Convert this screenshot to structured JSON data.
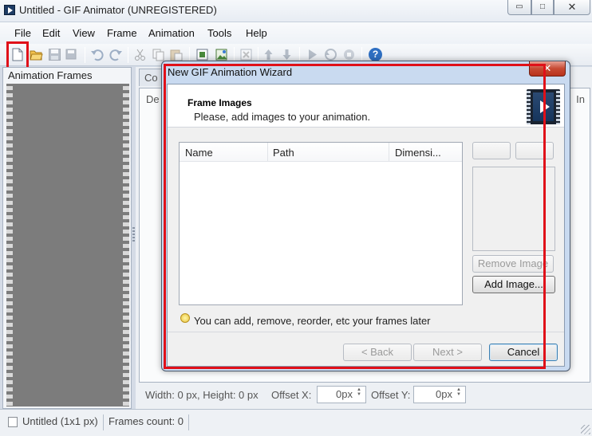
{
  "window": {
    "title": "Untitled - GIF Animator (UNREGISTERED)",
    "minimize_glyph": "▭",
    "maximize_glyph": "□",
    "close_glyph": "✕"
  },
  "menu": [
    "File",
    "Edit",
    "View",
    "Frame",
    "Animation",
    "Tools",
    "Help"
  ],
  "toolbar": {
    "icons": [
      "new-file-icon",
      "open-folder-icon",
      "save-icon",
      "save-as-icon",
      "undo-icon",
      "redo-icon",
      "cut-icon",
      "copy-icon",
      "paste-icon",
      "add-frame-icon",
      "insert-image-icon",
      "delete-frame-icon",
      "move-up-icon",
      "move-down-icon",
      "play-icon",
      "rewind-icon",
      "stop-icon",
      "help-icon"
    ],
    "help_glyph": "?"
  },
  "left_panel": {
    "title": "Animation Frames"
  },
  "right_panel": {
    "tab_label": "Co",
    "inner_tab_left": "De",
    "inner_tab_right": "In",
    "size_text": "Width: 0 px, Height: 0 px",
    "offset_x_label": "Offset X:",
    "offset_x_value": "0px",
    "offset_y_label": "Offset Y:",
    "offset_y_value": "0px"
  },
  "status": {
    "file": "Untitled (1x1 px)",
    "frames": "Frames count: 0"
  },
  "dialog": {
    "title": "New GIF Animation Wizard",
    "close_glyph": "✕",
    "header_title": "Frame Images",
    "header_subtitle": "Please, add images to your animation.",
    "columns": [
      "Name",
      "Path",
      "Dimensi..."
    ],
    "remove_image": "Remove Image",
    "add_image": "Add Image...",
    "tip": "You can add, remove, reorder, etc your frames later",
    "back": "< Back",
    "next": "Next >",
    "cancel": "Cancel"
  },
  "colors": {
    "highlight": "#e01019"
  }
}
